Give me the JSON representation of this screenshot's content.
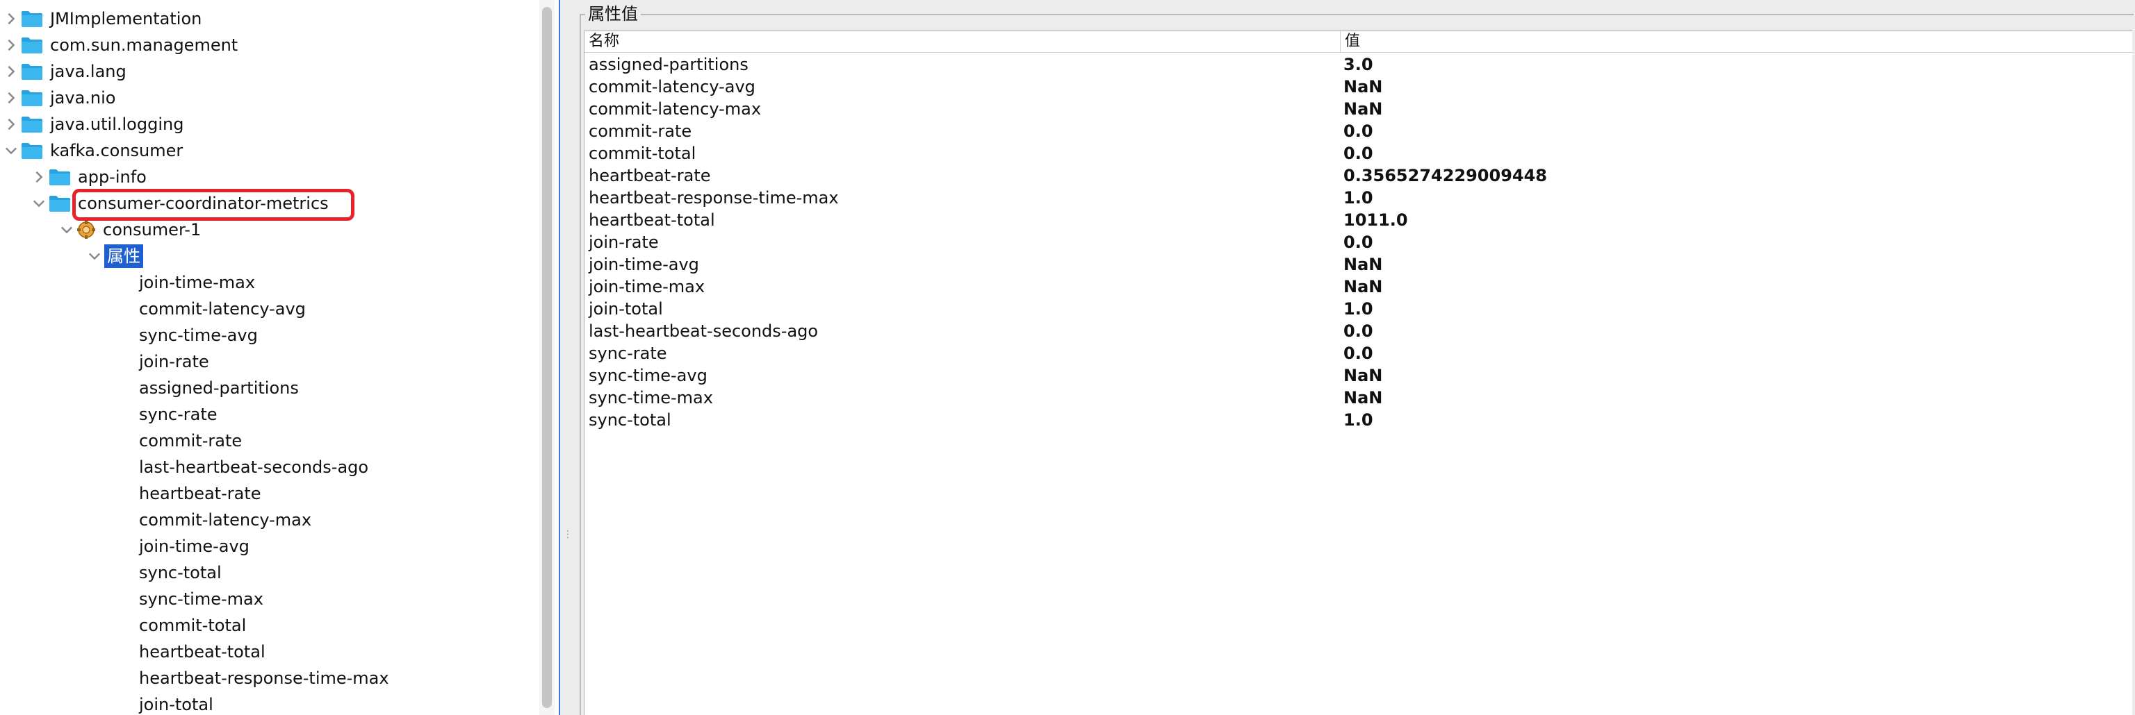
{
  "tree": {
    "top_items": [
      {
        "label": "JMImplementation"
      },
      {
        "label": "com.sun.management"
      },
      {
        "label": "java.lang"
      },
      {
        "label": "java.nio"
      },
      {
        "label": "java.util.logging"
      }
    ],
    "kafka_consumer": "kafka.consumer",
    "app_info": "app-info",
    "coordinator_metrics": "consumer-coordinator-metrics",
    "consumer_1": "consumer-1",
    "attributes_node": "属性",
    "attributes": [
      "join-time-max",
      "commit-latency-avg",
      "sync-time-avg",
      "join-rate",
      "assigned-partitions",
      "sync-rate",
      "commit-rate",
      "last-heartbeat-seconds-ago",
      "heartbeat-rate",
      "commit-latency-max",
      "join-time-avg",
      "sync-total",
      "sync-time-max",
      "commit-total",
      "heartbeat-total",
      "heartbeat-response-time-max",
      "join-total"
    ],
    "folder_color": "#29a3e0",
    "highlight_color": "#e8222b"
  },
  "value_panel": {
    "title": "属性值",
    "col_name": "名称",
    "col_value": "值",
    "rows": [
      {
        "name": "assigned-partitions",
        "value": "3.0"
      },
      {
        "name": "commit-latency-avg",
        "value": "NaN"
      },
      {
        "name": "commit-latency-max",
        "value": "NaN"
      },
      {
        "name": "commit-rate",
        "value": "0.0"
      },
      {
        "name": "commit-total",
        "value": "0.0"
      },
      {
        "name": "heartbeat-rate",
        "value": "0.3565274229009448"
      },
      {
        "name": "heartbeat-response-time-max",
        "value": "1.0"
      },
      {
        "name": "heartbeat-total",
        "value": "1011.0"
      },
      {
        "name": "join-rate",
        "value": "0.0"
      },
      {
        "name": "join-time-avg",
        "value": "NaN"
      },
      {
        "name": "join-time-max",
        "value": "NaN"
      },
      {
        "name": "join-total",
        "value": "1.0"
      },
      {
        "name": "last-heartbeat-seconds-ago",
        "value": "0.0"
      },
      {
        "name": "sync-rate",
        "value": "0.0"
      },
      {
        "name": "sync-time-avg",
        "value": "NaN"
      },
      {
        "name": "sync-time-max",
        "value": "NaN"
      },
      {
        "name": "sync-total",
        "value": "1.0"
      }
    ]
  }
}
